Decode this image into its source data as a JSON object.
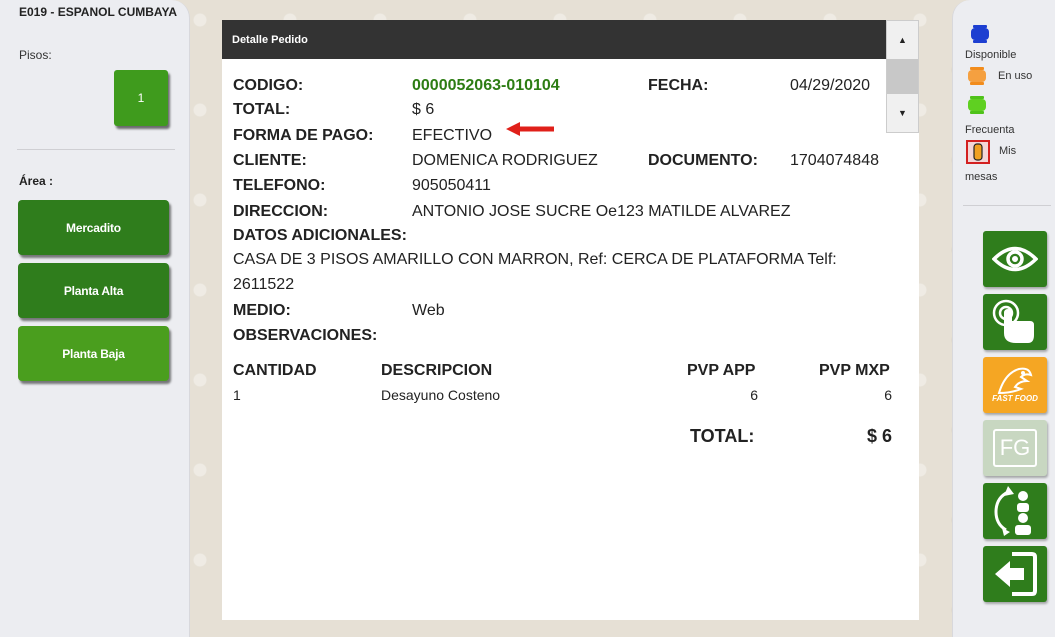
{
  "left": {
    "restaurant_name": "E019 - ESPANOL CUMBAYA",
    "pisos_label": "Pisos:",
    "piso_button": "1",
    "area_label": "Área :",
    "areas": [
      "Mercadito",
      "Planta Alta",
      "Planta Baja"
    ]
  },
  "panel": {
    "title": "Detalle Pedido",
    "codigo_label": "CODIGO:",
    "codigo": "0000052063-010104",
    "fecha_label": "FECHA:",
    "fecha": "04/29/2020",
    "total_label": "TOTAL:",
    "total": "$ 6",
    "forma_pago_label": "FORMA DE PAGO:",
    "forma_pago": "EFECTIVO",
    "cliente_label": "CLIENTE:",
    "cliente": "DOMENICA RODRIGUEZ",
    "documento_label": "DOCUMENTO:",
    "documento": "1704074848",
    "telefono_label": "TELEFONO:",
    "telefono": "905050411",
    "direccion_label": "DIRECCION:",
    "direccion": "ANTONIO JOSE SUCRE Oe123 MATILDE ALVAREZ",
    "datos_label": "DATOS ADICIONALES:",
    "datos_line1": "CASA DE 3 PISOS AMARILLO CON MARRON, Ref: CERCA DE PLATAFORMA Telf:",
    "datos_line2": "2611522",
    "medio_label": "MEDIO:",
    "medio": "Web",
    "observaciones_label": "OBSERVACIONES:",
    "columns": [
      "CANTIDAD",
      "DESCRIPCION",
      "PVP APP",
      "PVP MXP"
    ],
    "items": [
      {
        "cantidad": "1",
        "descripcion": "Desayuno Costeno",
        "pvp_app": "6",
        "pvp_mxp": "6"
      }
    ],
    "total_footer_label": "TOTAL:",
    "total_footer": "$ 6"
  },
  "legend": {
    "disponible": "Disponible",
    "en_uso": "En uso",
    "frecuenta": "Frecuenta",
    "mis": "Mis",
    "mesas": "mesas"
  },
  "buttons": {
    "fast_food": "FAST FOOD",
    "fg": "FG"
  },
  "colors": {
    "accent_green": "#2f7d1c",
    "code_green": "#2d7d14",
    "header_dark": "#333333",
    "orange": "#f5a623",
    "arrow_red": "#e0201a"
  },
  "icons": [
    "chevron-up-icon",
    "chevron-down-icon",
    "red-arrow-icon",
    "blue-table-icon",
    "orange-table-icon",
    "green-table-icon",
    "red-table-icon",
    "eye-icon",
    "touch-icon",
    "fast-food-icon",
    "fg-icon",
    "waiter-switch-icon",
    "exit-icon"
  ]
}
